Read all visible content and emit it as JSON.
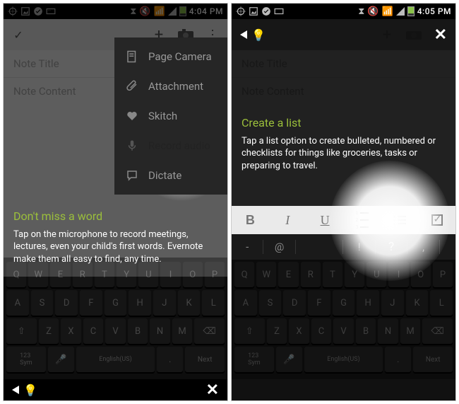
{
  "status": {
    "time_left": "4:04 PM",
    "time_right": "4:05 PM"
  },
  "note": {
    "title_placeholder": "Note Title",
    "content_placeholder": "Note Content"
  },
  "dropdown": {
    "items": [
      {
        "label": "Page Camera"
      },
      {
        "label": "Attachment"
      },
      {
        "label": "Skitch"
      },
      {
        "label": "Record audio"
      },
      {
        "label": "Dictate"
      }
    ]
  },
  "coach1": {
    "title": "Don't miss a word",
    "body": "Tap on the microphone to record meetings, lectures, even your child's first words. Evernote make them all easy to find, any time."
  },
  "coach2": {
    "title": "Create a list",
    "body": "Tap a list option to create bulleted, numbered or checklists for things like groceries, tasks or preparing to travel."
  },
  "keyboard": {
    "row1": [
      "Q",
      "W",
      "E",
      "R",
      "T",
      "Y",
      "U",
      "I",
      "O",
      "P"
    ],
    "row2": [
      "A",
      "S",
      "D",
      "F",
      "G",
      "H",
      "J",
      "K",
      "L"
    ],
    "row3_shift": "⇧",
    "row3": [
      "Z",
      "X",
      "C",
      "V",
      "B",
      "N",
      "M"
    ],
    "row3_del": "⌫",
    "sym": "123\nSym",
    "mic": "🎤",
    "space": "English(US)",
    "dot": ".",
    "next": "Next"
  },
  "format_toolbar": {
    "bold": "B",
    "italic": "I",
    "underline": "U"
  },
  "punct": {
    "dash": "-",
    "at": "@",
    "excl": "!",
    "quest": "?",
    "comma": ","
  }
}
